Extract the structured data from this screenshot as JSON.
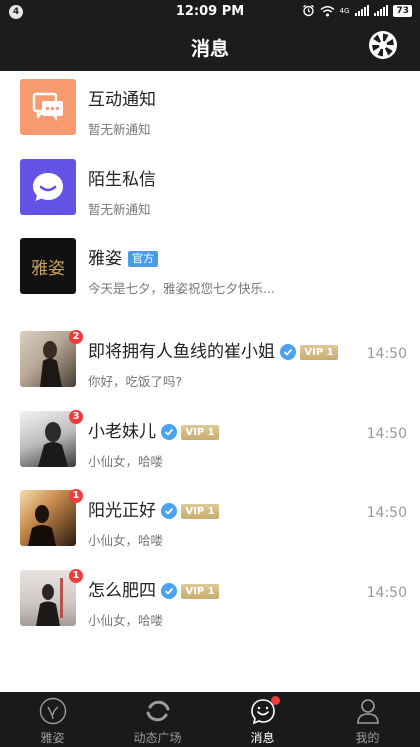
{
  "status_bar": {
    "notification_count": "4",
    "time": "12:09 PM",
    "network_label": "4G",
    "battery": "73"
  },
  "header": {
    "title": "消息",
    "right_icon": "camera-shutter-icon"
  },
  "system_items": [
    {
      "title": "互动通知",
      "subtitle": "暂无新通知",
      "icon": "chat-bubbles-icon",
      "color": "#f89a70"
    },
    {
      "title": "陌生私信",
      "subtitle": "暂无新通知",
      "icon": "message-bubble-icon",
      "color": "#6352e6"
    },
    {
      "title": "雅姿",
      "tag": "官方",
      "subtitle": "今天是七夕，雅姿祝您七夕快乐...",
      "logo_text": "雅姿",
      "color": "#111111"
    }
  ],
  "conversations": [
    {
      "name": "即将拥有人鱼线的崔小姐",
      "badge": "2",
      "vip": "VIP 1",
      "message": "你好，吃饭了吗?",
      "time": "14:50"
    },
    {
      "name": "小老妹儿",
      "badge": "3",
      "vip": "VIP 1",
      "message": "小仙女，哈喽",
      "time": "14:50"
    },
    {
      "name": "阳光正好",
      "badge": "1",
      "vip": "VIP 1",
      "message": "小仙女，哈喽",
      "time": "14:50"
    },
    {
      "name": "怎么肥四",
      "badge": "1",
      "vip": "VIP 1",
      "message": "小仙女，哈喽",
      "time": "14:50"
    }
  ],
  "tab_bar": [
    {
      "label": "雅姿",
      "icon": "yazi-logo-icon",
      "active": false
    },
    {
      "label": "动态广场",
      "icon": "refresh-circle-icon",
      "active": false
    },
    {
      "label": "消息",
      "icon": "message-face-icon",
      "active": true,
      "dot": true
    },
    {
      "label": "我的",
      "icon": "person-icon",
      "active": false
    }
  ],
  "colors": {
    "accent_badge": "#f23b3b",
    "verified": "#4aa2f0",
    "vip_gold": "#c9ab6c",
    "bar_bg": "#1c1c1c"
  }
}
